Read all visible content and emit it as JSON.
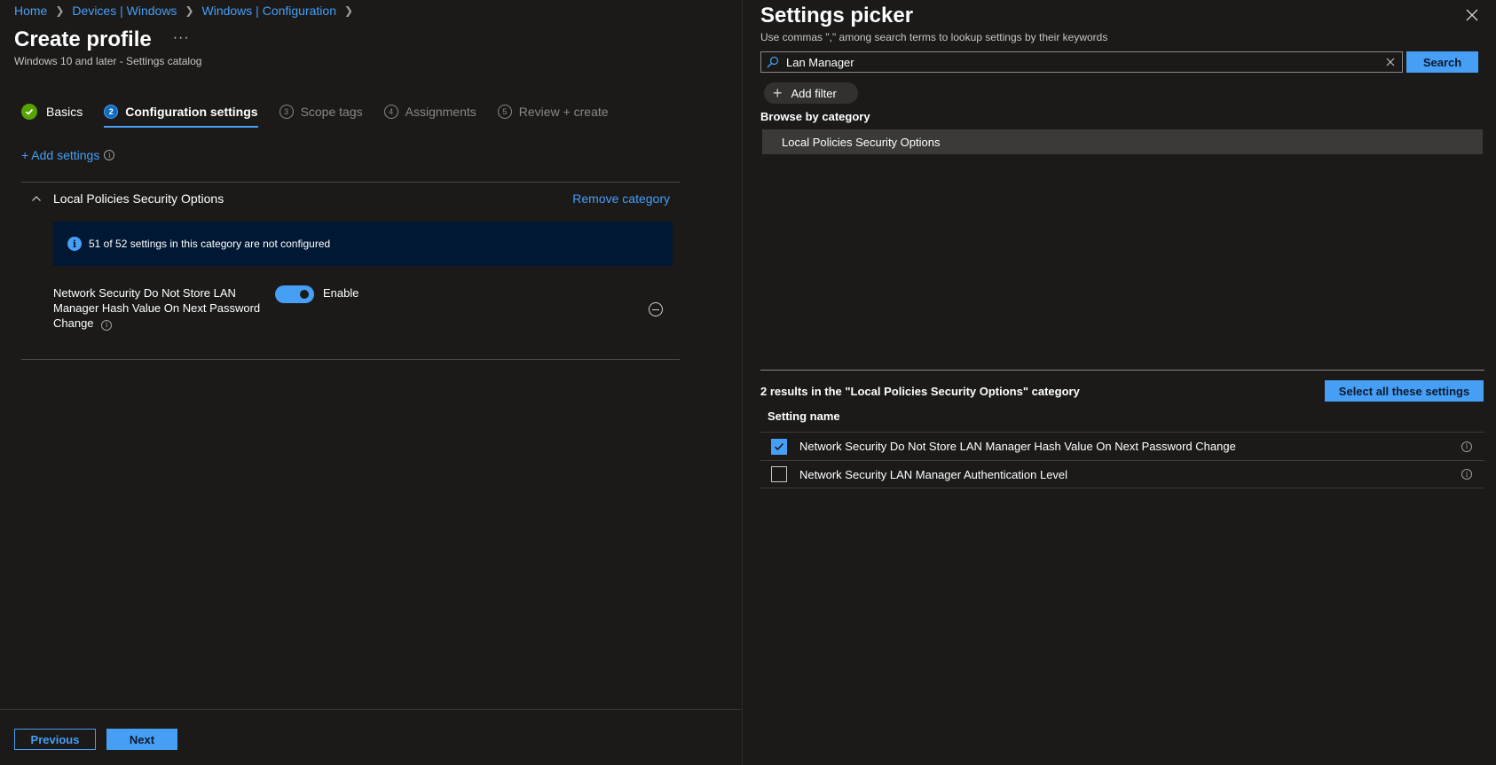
{
  "breadcrumb": [
    "Home",
    "Devices | Windows",
    "Windows | Configuration"
  ],
  "page": {
    "title": "Create profile",
    "more": "···",
    "subtitle": "Windows 10 and later - Settings catalog"
  },
  "steps": [
    {
      "num": "",
      "label": "Basics"
    },
    {
      "num": "2",
      "label": "Configuration settings"
    },
    {
      "num": "3",
      "label": "Scope tags"
    },
    {
      "num": "4",
      "label": "Assignments"
    },
    {
      "num": "5",
      "label": "Review + create"
    }
  ],
  "add_settings": "+ Add settings",
  "category": {
    "title": "Local Policies Security Options",
    "remove": "Remove category",
    "banner": "51 of 52 settings in this category are not configured",
    "setting_name": "Network Security Do Not Store LAN Manager Hash Value On Next Password Change",
    "toggle_label": "Enable",
    "toggle_on": true
  },
  "footer": {
    "previous": "Previous",
    "next": "Next"
  },
  "picker": {
    "title": "Settings picker",
    "subtitle": "Use commas \",\" among search terms to lookup settings by their keywords",
    "search_value": "Lan Manager",
    "search_button": "Search",
    "add_filter": "Add filter",
    "browse_label": "Browse by category",
    "category_item": "Local Policies Security Options",
    "results_label": "2 results in the \"Local Policies Security Options\" category",
    "select_all": "Select all these settings",
    "column_header": "Setting name",
    "results": [
      {
        "label": "Network Security Do Not Store LAN Manager Hash Value On Next Password Change",
        "checked": true
      },
      {
        "label": "Network Security LAN Manager Authentication Level",
        "checked": false
      }
    ]
  },
  "colors": {
    "accent": "#479ef5",
    "success": "#57a300",
    "banner_bg": "#001833",
    "background": "#1b1a19"
  }
}
